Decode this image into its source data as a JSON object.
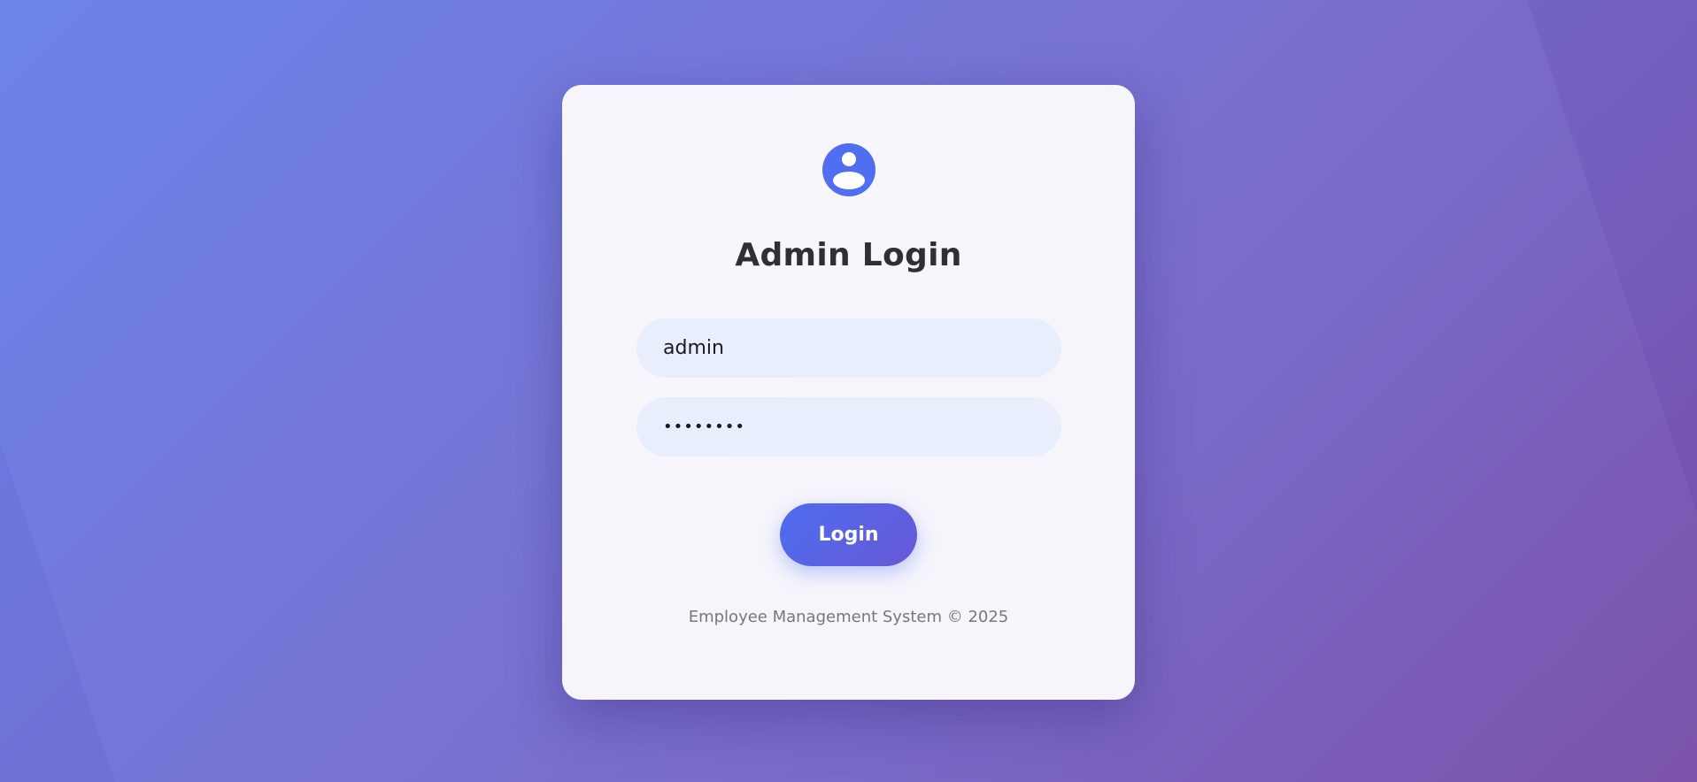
{
  "login": {
    "title": "Admin Login",
    "username_value": "admin",
    "password_value": "password",
    "button_label": "Login",
    "footer_text": "Employee Management System © 2025",
    "avatar_icon": "user-circle-icon"
  },
  "colors": {
    "accent": "#4f6ef2",
    "background_start": "#6b84ea",
    "background_end": "#7b52aa",
    "input_background": "#e8eefb"
  }
}
